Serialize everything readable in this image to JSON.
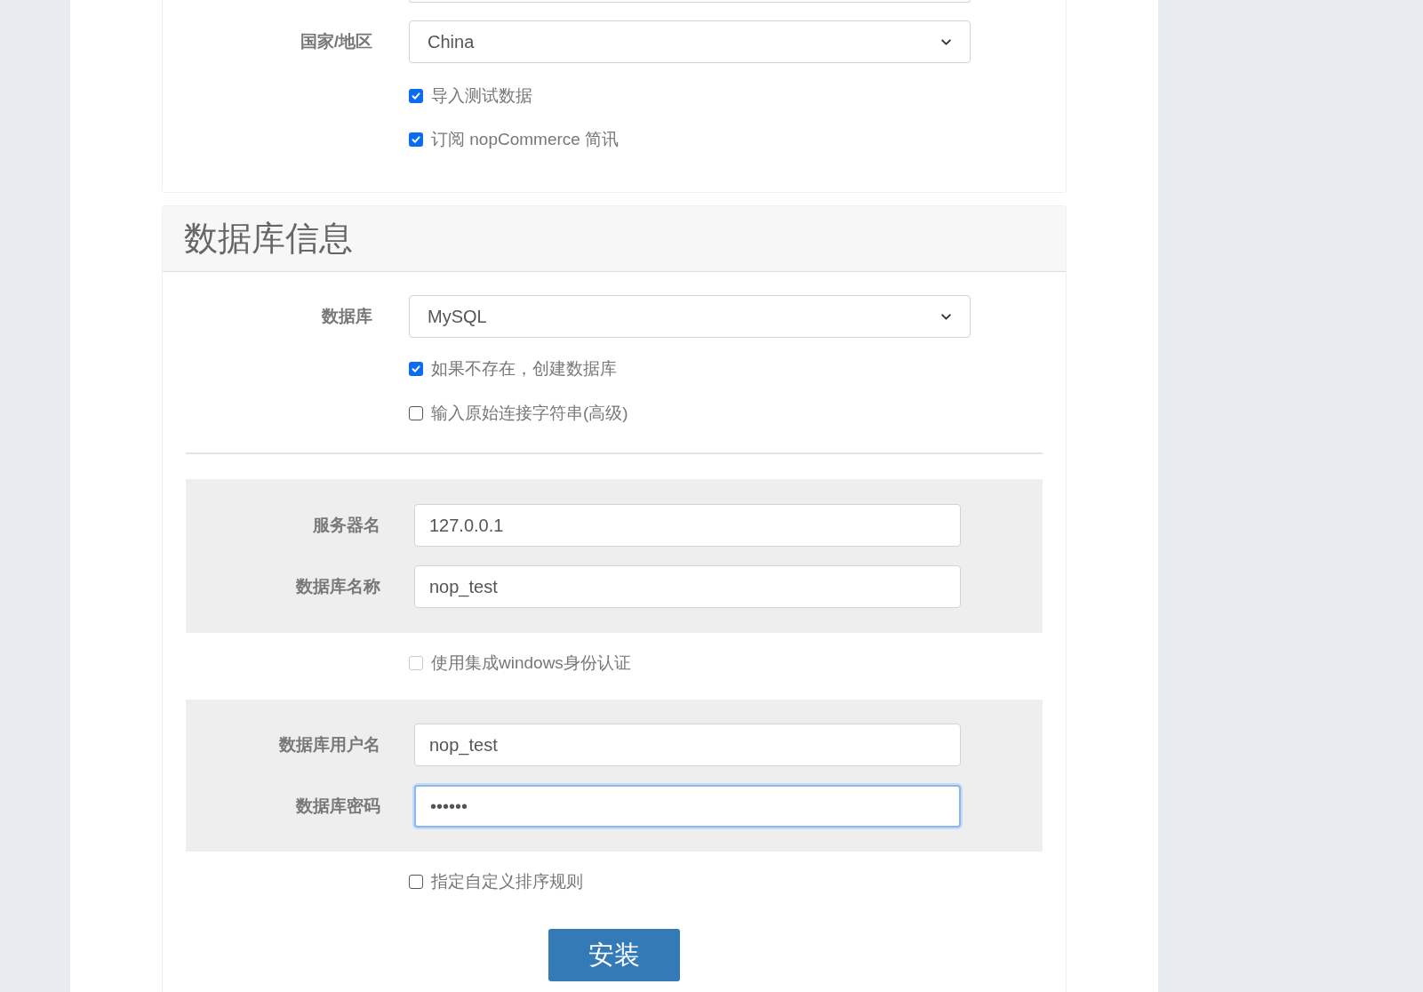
{
  "store_section": {
    "items": [
      {
        "kind": "select",
        "label": "国家/地区",
        "value": "China"
      },
      {
        "kind": "checkbox",
        "label": "导入测试数据",
        "checked": true,
        "disabled": false
      },
      {
        "kind": "checkbox",
        "label": "订阅 nopCommerce 简讯",
        "checked": true,
        "disabled": false
      }
    ]
  },
  "database_section": {
    "title": "数据库信息",
    "items": [
      {
        "kind": "select",
        "label": "数据库",
        "value": "MySQL"
      },
      {
        "kind": "checkbox",
        "label": "如果不存在，创建数据库",
        "checked": true,
        "disabled": false
      },
      {
        "kind": "checkbox",
        "label": "输入原始连接字符串(高级)",
        "checked": false,
        "disabled": false
      },
      {
        "kind": "divider"
      },
      {
        "kind": "panel",
        "fields": [
          {
            "label": "服务器名",
            "value": "127.0.0.1",
            "focused": false
          },
          {
            "label": "数据库名称",
            "value": "nop_test",
            "focused": false
          }
        ]
      },
      {
        "kind": "checkbox",
        "label": "使用集成windows身份认证",
        "checked": false,
        "disabled": true
      },
      {
        "kind": "panel",
        "fields": [
          {
            "label": "数据库用户名",
            "value": "nop_test",
            "focused": false
          },
          {
            "label": "数据库密码",
            "value": "••••••",
            "focused": true
          }
        ]
      },
      {
        "kind": "checkbox",
        "label": "指定自定义排序规则",
        "checked": false,
        "disabled": false
      }
    ]
  },
  "install_button": "安装"
}
